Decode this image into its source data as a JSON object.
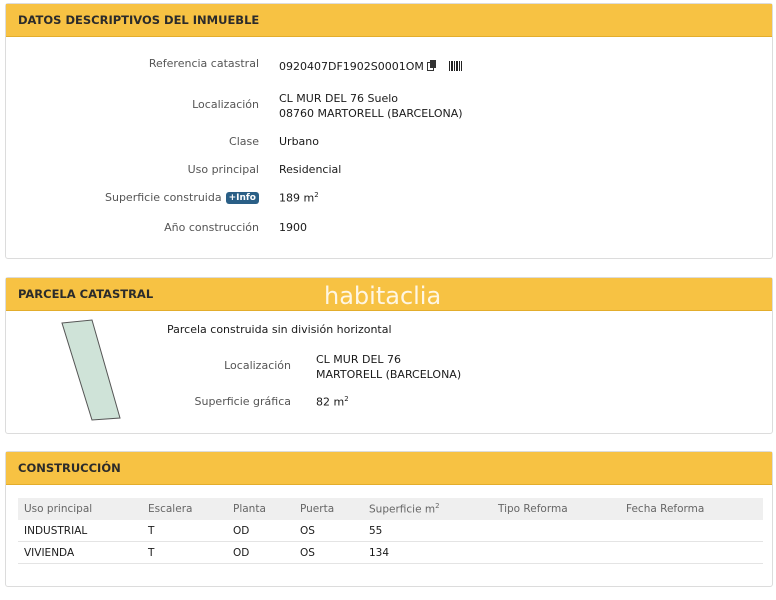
{
  "datos": {
    "title": "DATOS DESCRIPTIVOS DEL INMUEBLE",
    "ref_label": "Referencia catastral",
    "ref_value": "0920407DF1902S0001OM",
    "loc_label": "Localización",
    "loc_line1": "CL MUR DEL 76 Suelo",
    "loc_line2": "08760 MARTORELL (BARCELONA)",
    "clase_label": "Clase",
    "clase_value": "Urbano",
    "uso_label": "Uso principal",
    "uso_value": "Residencial",
    "sup_label": "Superficie construida",
    "info_badge": "+Info",
    "sup_value": "189 m",
    "sup_unit_sup": "2",
    "anio_label": "Año construcción",
    "anio_value": "1900"
  },
  "parcela": {
    "title": "PARCELA CATASTRAL",
    "subtitle": "Parcela construida sin división horizontal",
    "loc_label": "Localización",
    "loc_line1": "CL MUR DEL 76",
    "loc_line2": "MARTORELL (BARCELONA)",
    "sup_label": "Superficie gráfica",
    "sup_value": "82 m",
    "sup_unit_sup": "2",
    "map_fill": "#cfe3d8"
  },
  "watermark": "habitaclia",
  "construccion": {
    "title": "CONSTRUCCIÓN",
    "headers": [
      "Uso principal",
      "Escalera",
      "Planta",
      "Puerta",
      "Superficie m",
      "Tipo Reforma",
      "Fecha Reforma"
    ],
    "header_sup": "2",
    "rows": [
      [
        "INDUSTRIAL",
        "T",
        "OD",
        "OS",
        "55",
        "",
        ""
      ],
      [
        "VIVIENDA",
        "T",
        "OD",
        "OS",
        "134",
        "",
        ""
      ]
    ]
  },
  "colors": {
    "header_bg": "#f7c243",
    "badge_bg": "#2a5f86"
  },
  "icons": [
    "copy-icon",
    "barcode-icon"
  ]
}
